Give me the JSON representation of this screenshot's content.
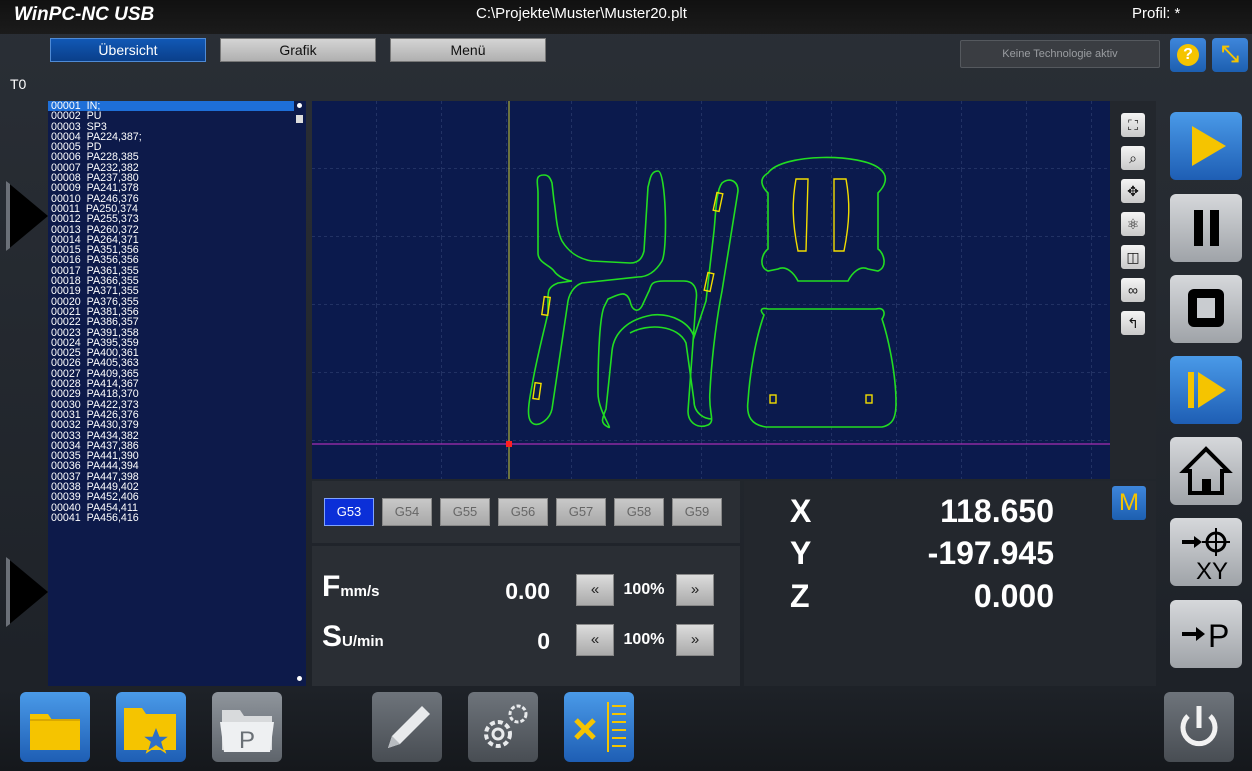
{
  "title_bar": {
    "app_title": "WinPC-NC USB",
    "file_path": "C:\\Projekte\\Muster\\Muster20.plt",
    "profile": "Profil: *"
  },
  "tabs": {
    "overview": "Übersicht",
    "graphic": "Grafik",
    "menu": "Menü"
  },
  "tech_status": "Keine Technologie aktiv",
  "help_glyph": "?",
  "tool_label": "T0",
  "code_list": [
    "00001  IN;",
    "00002  PU",
    "00003  SP3",
    "00004  PA224,387;",
    "00005  PD",
    "00006  PA228,385",
    "00007  PA232,382",
    "00008  PA237,380",
    "00009  PA241,378",
    "00010  PA246,376",
    "00011  PA250,374",
    "00012  PA255,373",
    "00013  PA260,372",
    "00014  PA264,371",
    "00015  PA351,356",
    "00016  PA356,356",
    "00017  PA361,355",
    "00018  PA366,355",
    "00019  PA371,355",
    "00020  PA376,355",
    "00021  PA381,356",
    "00022  PA386,357",
    "00023  PA391,358",
    "00024  PA395,359",
    "00025  PA400,361",
    "00026  PA405,363",
    "00027  PA409,365",
    "00028  PA414,367",
    "00029  PA418,370",
    "00030  PA422,373",
    "00031  PA426,376",
    "00032  PA430,379",
    "00033  PA434,382",
    "00034  PA437,386",
    "00035  PA441,390",
    "00036  PA444,394",
    "00037  PA447,398",
    "00038  PA449,402",
    "00039  PA452,406",
    "00040  PA454,411",
    "00041  PA456,416"
  ],
  "offsets": [
    "G53",
    "G54",
    "G55",
    "G56",
    "G57",
    "G58",
    "G59"
  ],
  "active_offset": "G53",
  "feed": {
    "label": "F",
    "unit": "mm/s",
    "value": "0.00",
    "override": "100%",
    "dec": "«",
    "inc": "»"
  },
  "spindle": {
    "label": "S",
    "unit": "U/min",
    "value": "0",
    "override": "100%",
    "dec": "«",
    "inc": "»"
  },
  "positions": {
    "x_label": "X",
    "x_value": "118.650",
    "y_label": "Y",
    "y_value": "-197.945",
    "z_label": "Z",
    "z_value": "0.000"
  },
  "mode_badge": "M",
  "controls": {
    "goto_xy_label": "XY",
    "goto_p_label": "P"
  },
  "colors": {
    "accent_blue": "#1e6fd8",
    "graphic_bg": "#0b1a4d",
    "contour_green": "#22dd22",
    "pocket_yellow": "#f2dd00",
    "brand_yellow": "#f5c400"
  }
}
